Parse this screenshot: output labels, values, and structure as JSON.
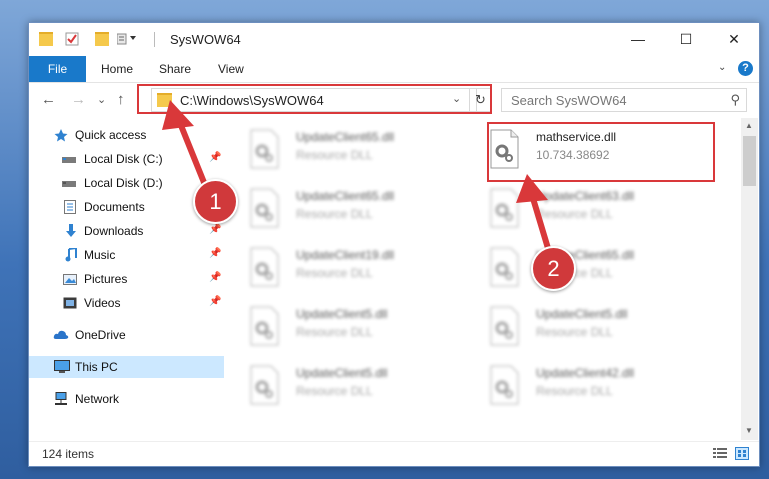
{
  "window": {
    "title": "SysWOW64",
    "minimize_glyph": "—",
    "maximize_glyph": "☐",
    "close_glyph": "✕"
  },
  "ribbon": {
    "tabs": [
      "File",
      "Home",
      "Share",
      "View"
    ],
    "help_glyph": "?",
    "expand_glyph": "⌄"
  },
  "nav": {
    "back_glyph": "←",
    "forward_glyph": "→",
    "recent_glyph": "⌄",
    "up_glyph": "↑",
    "address": "C:\\Windows\\SysWOW64",
    "address_dropdown_glyph": "⌄",
    "refresh_glyph": "↻",
    "search_placeholder": "Search SysWOW64",
    "search_glyph": "⚲"
  },
  "sidebar": {
    "items": [
      {
        "label": "Quick access",
        "icon": "star-icon"
      },
      {
        "label": "Local Disk (C:)",
        "icon": "drive-icon"
      },
      {
        "label": "Local Disk (D:)",
        "icon": "drive-icon"
      },
      {
        "label": "Documents",
        "icon": "documents-icon"
      },
      {
        "label": "Downloads",
        "icon": "download-icon"
      },
      {
        "label": "Music",
        "icon": "music-icon"
      },
      {
        "label": "Pictures",
        "icon": "pictures-icon"
      },
      {
        "label": "Videos",
        "icon": "videos-icon"
      },
      {
        "label": "OneDrive",
        "icon": "cloud-icon"
      },
      {
        "label": "This PC",
        "icon": "computer-icon",
        "selected": true
      },
      {
        "label": "Network",
        "icon": "network-icon"
      }
    ],
    "pin_glyph": "📌"
  },
  "files": {
    "left": [
      {
        "name": "UpdateClient65.dll",
        "type": "Resource DLL"
      },
      {
        "name": "UpdateClient65.dll",
        "type": "Resource DLL"
      },
      {
        "name": "UpdateClient19.dll",
        "type": "Resource DLL"
      },
      {
        "name": "UpdateClient5.dll",
        "type": "Resource DLL"
      },
      {
        "name": "UpdateClient5.dll",
        "type": "Resource DLL"
      }
    ],
    "highlighted": {
      "name": "mathservice.dll",
      "version": "10.734.38692"
    },
    "right": [
      {
        "name": "UpdateClient63.dll",
        "type": "Resource DLL"
      },
      {
        "name": "UpdateClient65.dll",
        "type": "Resource DLL"
      },
      {
        "name": "UpdateClient5.dll",
        "type": "Resource DLL"
      },
      {
        "name": "UpdateClient42.dll",
        "type": "Resource DLL"
      }
    ]
  },
  "status": {
    "item_count": "124 items"
  },
  "annotations": {
    "step1": "1",
    "step2": "2",
    "color": "#d9383a"
  }
}
